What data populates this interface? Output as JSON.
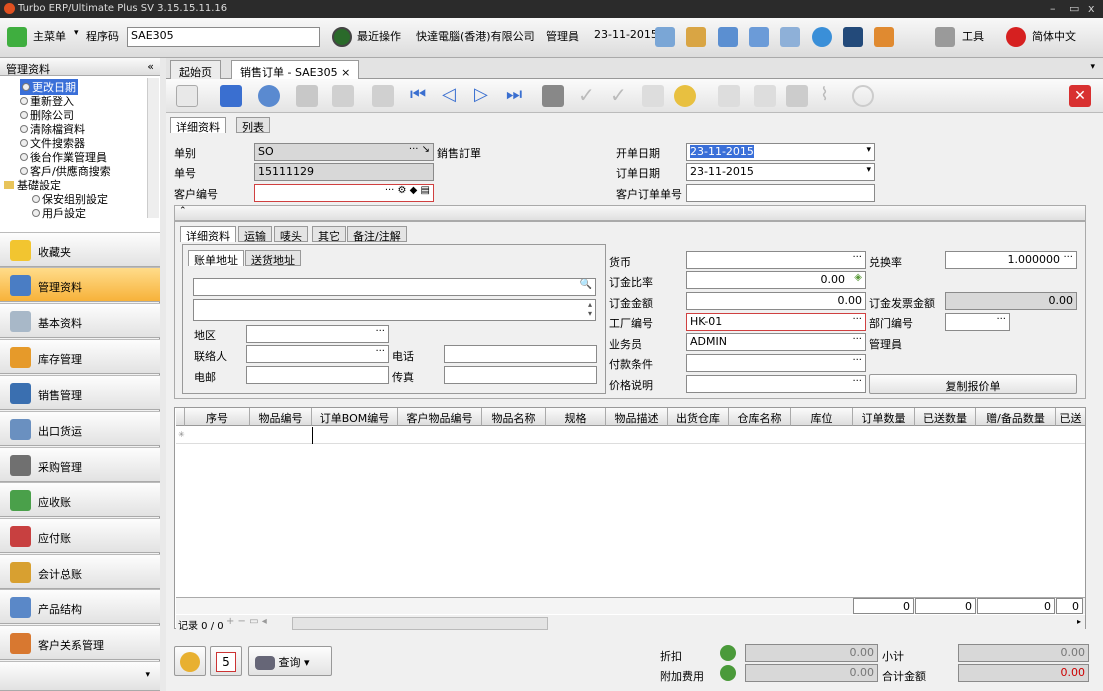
{
  "app": {
    "title": "Turbo ERP/Ultimate Plus SV 3.15.15.11.16"
  },
  "topbar": {
    "main_menu": "主菜单",
    "prog_code_label": "程序码",
    "prog_code_value": "SAE305",
    "recent_ops": "最近操作",
    "company": "快達電腦(香港)有限公司",
    "user": "管理員",
    "date": "23-11-2015",
    "tools": "工具",
    "language": "简体中文"
  },
  "leftpanel": {
    "header": "管理资料",
    "collapse": "«",
    "tree": [
      "更改日期",
      "重新登入",
      "删除公司",
      "清除檔資料",
      "文件搜索器",
      "後台作業管理員",
      "客戶/供應商搜索",
      "基礎設定",
      "保安组别設定",
      "用戶設定"
    ],
    "nav": [
      "收藏夹",
      "管理资料",
      "基本资料",
      "库存管理",
      "销售管理",
      "出口货运",
      "采购管理",
      "应收账",
      "应付账",
      "会计总账",
      "产品结构",
      "客户关系管理"
    ]
  },
  "tabs": {
    "home": "起始页",
    "active": "销售订单 - SAE305",
    "close": "×"
  },
  "detail_tabs": [
    "详细资料",
    "列表"
  ],
  "header_form": {
    "type_label": "单别",
    "type_value": "SO",
    "type_desc": "銷售訂單",
    "no_label": "单号",
    "no_value": "15111129",
    "cust_label": "客户编号",
    "cust_value": "",
    "open_date_label": "开单日期",
    "open_date_value": "23-11-2015",
    "order_date_label": "订单日期",
    "order_date_value": "23-11-2015",
    "cust_order_label": "客户订单单号",
    "cust_order_value": ""
  },
  "inner_tabs": [
    "详细资料",
    "运输",
    "唛头",
    "其它",
    "备注/注解"
  ],
  "addr_tabs": [
    "账单地址",
    "送货地址"
  ],
  "addr_form": {
    "region_label": "地区",
    "contact_label": "联络人",
    "phone_label": "电话",
    "email_label": "电邮",
    "fax_label": "传真"
  },
  "right_form": {
    "currency_label": "货币",
    "rate_label": "兑换率",
    "rate_value": "1.000000",
    "deposit_ratio_label": "订金比率",
    "deposit_ratio_value": "0.00",
    "deposit_amt_label": "订金金额",
    "deposit_amt_value": "0.00",
    "deposit_inv_label": "订金发票金额",
    "deposit_inv_value": "0.00",
    "factory_label": "工厂编号",
    "factory_value": "HK-01",
    "dept_label": "部门编号",
    "sales_label": "业务员",
    "sales_value": "ADMIN",
    "sales_desc": "管理員",
    "payment_label": "付款条件",
    "price_label": "价格说明",
    "copy_quote": "复制报价单"
  },
  "grid": {
    "columns": [
      "序号",
      "物品编号",
      "订单BOM编号",
      "客户物品编号",
      "物品名称",
      "规格",
      "物品描述",
      "出货仓库",
      "仓库名称",
      "库位",
      "订单数量",
      "已送数量",
      "赠/备品数量",
      "已送"
    ],
    "totals": [
      "0",
      "0",
      "0",
      "0"
    ],
    "record": "记录 0 / 0"
  },
  "footer": {
    "query": "查询",
    "calendar_day": "5",
    "discount_label": "折扣",
    "discount_value": "0.00",
    "extra_label": "附加费用",
    "extra_value": "0.00",
    "subtotal_label": "小计",
    "subtotal_value": "0.00",
    "total_label": "合计金额",
    "total_value": "0.00"
  }
}
